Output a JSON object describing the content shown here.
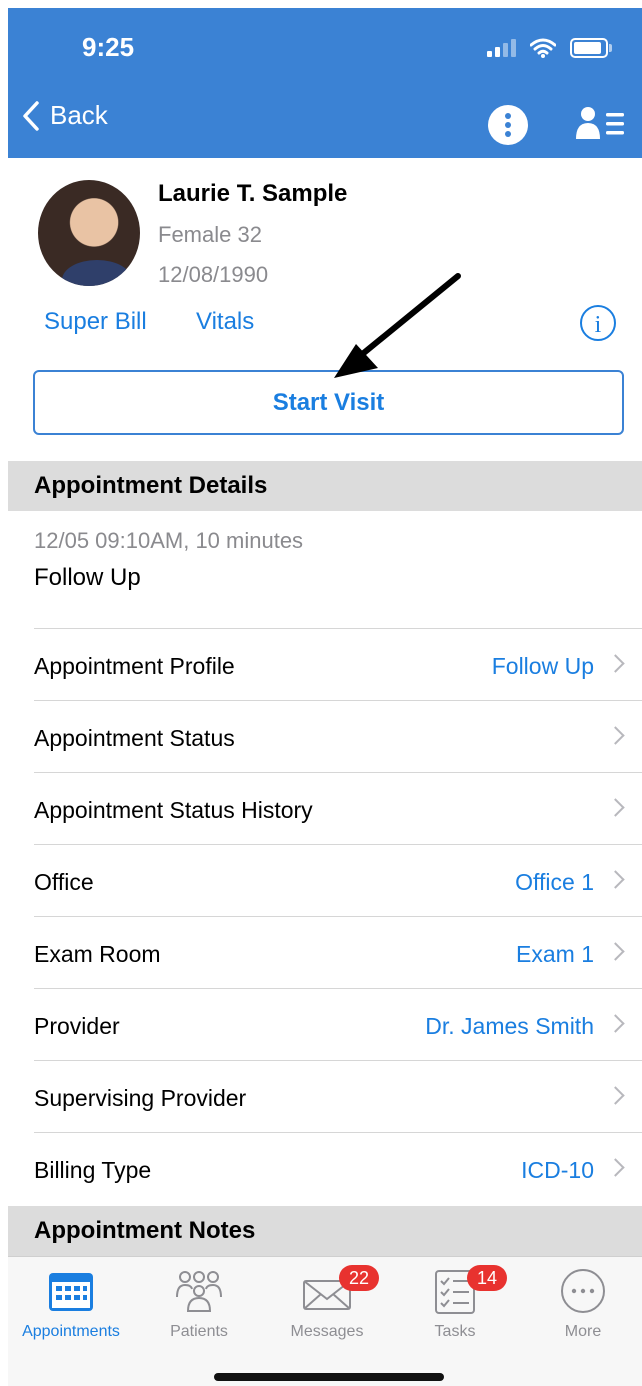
{
  "status_bar": {
    "time": "9:25"
  },
  "nav": {
    "back_label": "Back"
  },
  "patient": {
    "name": "Laurie T. Sample",
    "gender_age": "Female 32",
    "dob": "12/08/1990"
  },
  "links": {
    "super_bill": "Super Bill",
    "vitals": "Vitals",
    "info_glyph": "i"
  },
  "start_visit_label": "Start Visit",
  "appointment_details": {
    "header": "Appointment Details",
    "datetime": "12/05 09:10AM, 10 minutes",
    "type": "Follow Up"
  },
  "rows": [
    {
      "label": "Appointment Profile",
      "value": "Follow  Up"
    },
    {
      "label": "Appointment Status",
      "value": ""
    },
    {
      "label": "Appointment Status History",
      "value": ""
    },
    {
      "label": "Office",
      "value": "Office 1"
    },
    {
      "label": "Exam Room",
      "value": "Exam 1"
    },
    {
      "label": "Provider",
      "value": "Dr. James Smith"
    },
    {
      "label": "Supervising Provider",
      "value": ""
    },
    {
      "label": "Billing Type",
      "value": "ICD-10"
    }
  ],
  "appointment_notes": {
    "header": "Appointment Notes"
  },
  "tabs": [
    {
      "label": "Appointments",
      "icon": "calendar-icon",
      "active": true
    },
    {
      "label": "Patients",
      "icon": "people-icon"
    },
    {
      "label": "Messages",
      "icon": "envelope-icon",
      "badge": "22"
    },
    {
      "label": "Tasks",
      "icon": "checklist-icon",
      "badge": "14"
    },
    {
      "label": "More",
      "icon": "more-icon"
    }
  ],
  "colors": {
    "nav_blue": "#3b82d4",
    "link_blue": "#1a7ee0",
    "badge_red": "#e8322f",
    "section_gray": "#dcdcdc"
  }
}
